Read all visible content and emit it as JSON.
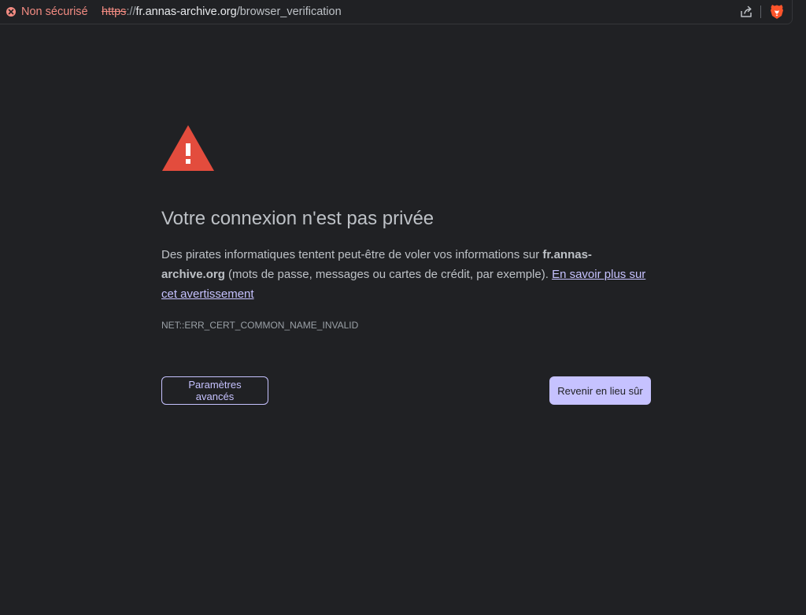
{
  "omnibox": {
    "security_label": "Non sécurisé",
    "url_scheme": "https",
    "url_separator": "://",
    "url_host": "fr.annas-archive.org",
    "url_path": "/browser_verification",
    "share_icon": "share-icon",
    "extension_icon": "brave-lion-icon"
  },
  "interstitial": {
    "icon": "warning-triangle-icon",
    "title": "Votre connexion n'est pas privée",
    "message_before": "Des pirates informatiques tentent peut-être de voler vos informations sur ",
    "message_host": "fr.annas-archive.org",
    "message_after": " (mots de passe, messages ou cartes de crédit, par exemple). ",
    "learn_more_link": "En savoir plus sur cet avertissement",
    "error_code": "NET::ERR_CERT_COMMON_NAME_INVALID",
    "advanced_button": "Paramètres avancés",
    "back_button": "Revenir en lieu sûr"
  },
  "colors": {
    "background": "#202124",
    "error_red": "#f28b82",
    "warning_red": "#e34c3d",
    "accent": "#c6c2ff",
    "text": "#bdc1c6"
  }
}
